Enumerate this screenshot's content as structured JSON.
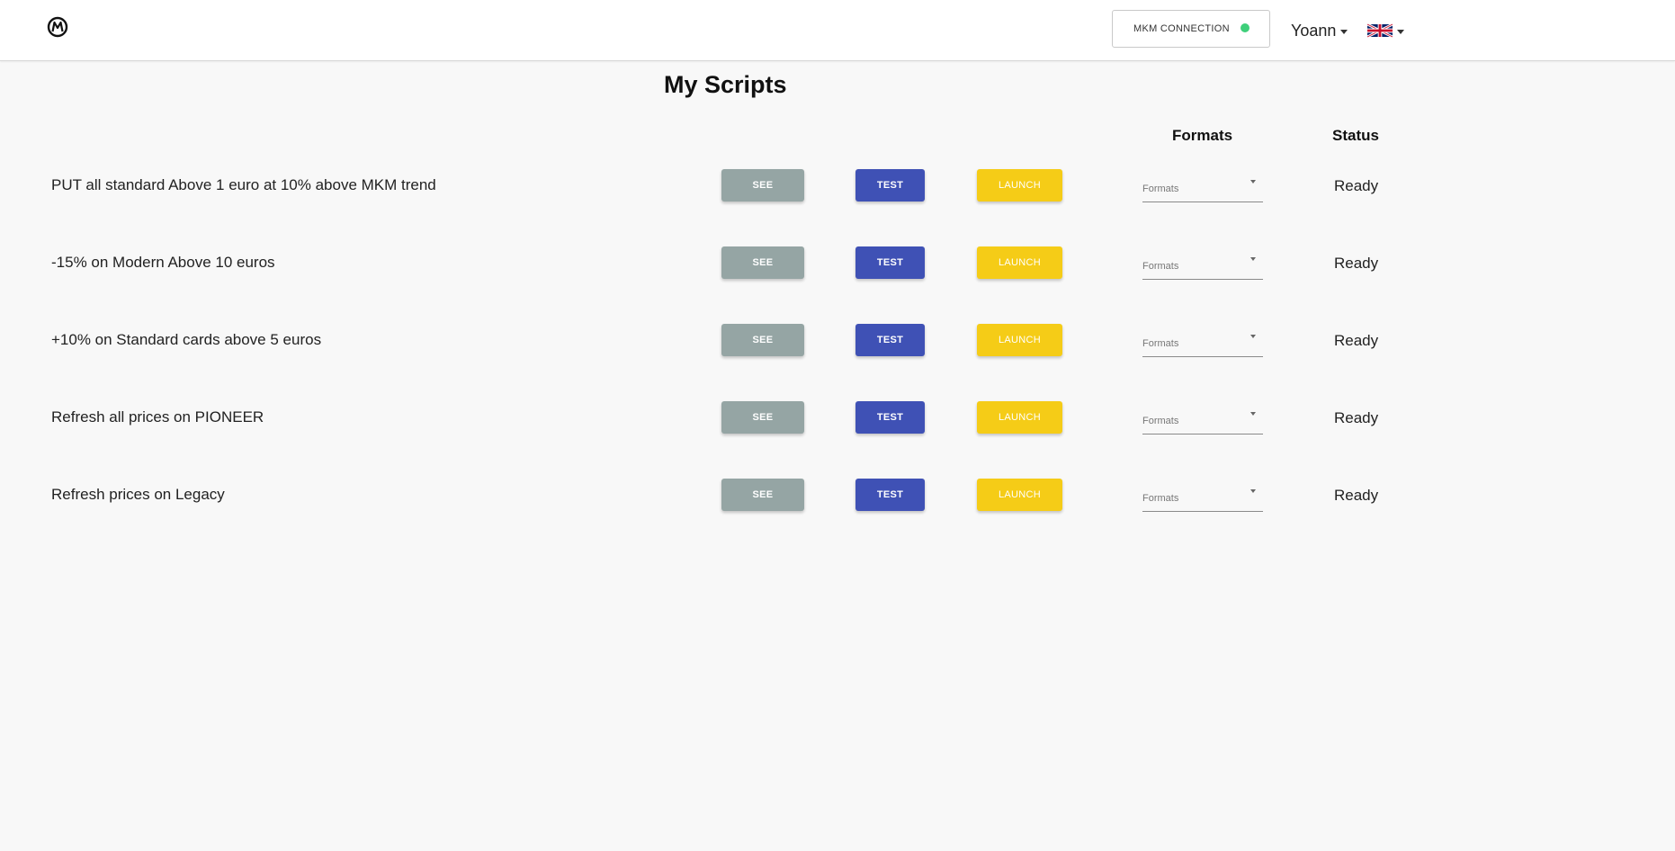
{
  "header": {
    "mkm_connection_label": "MKM CONNECTION",
    "mkm_status_color": "#3ecf7a",
    "user_name": "Yoann",
    "language_flag": "uk-flag-icon",
    "logo": "logo-icon"
  },
  "page": {
    "title": "My Scripts"
  },
  "columns": {
    "formats": "Formats",
    "status": "Status"
  },
  "buttons": {
    "see": "SEE",
    "test": "TEST",
    "launch": "LAUNCH"
  },
  "colors": {
    "see": "#95a5a4",
    "test": "#3f51b5",
    "launch": "#f5cc17"
  },
  "scripts": [
    {
      "name": "PUT all standard Above 1 euro at 10% above MKM trend",
      "formats_placeholder": "Formats",
      "status": "Ready"
    },
    {
      "name": "-15% on Modern Above 10 euros",
      "formats_placeholder": "Formats",
      "status": "Ready"
    },
    {
      "name": "+10% on Standard cards above 5 euros",
      "formats_placeholder": "Formats",
      "status": "Ready"
    },
    {
      "name": "Refresh all prices on PIONEER",
      "formats_placeholder": "Formats",
      "status": "Ready"
    },
    {
      "name": "Refresh prices on Legacy",
      "formats_placeholder": "Formats",
      "status": "Ready"
    }
  ]
}
